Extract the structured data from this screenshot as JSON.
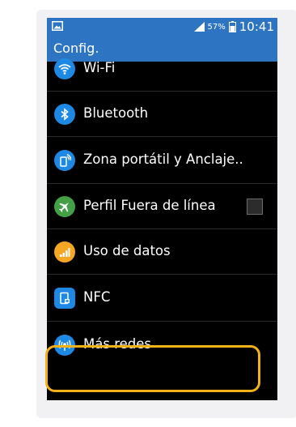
{
  "statusbar": {
    "battery": "57%",
    "time": "10:41"
  },
  "appbar": {
    "title": "Config."
  },
  "items": [
    {
      "label": "Wi-Fi",
      "icon": "wifi-icon",
      "color": "#1e88e5"
    },
    {
      "label": "Bluetooth",
      "icon": "bluetooth-icon",
      "color": "#1e88e5"
    },
    {
      "label": "Zona portátil y Anclaje..",
      "icon": "hotspot-icon",
      "color": "#1e88e5"
    },
    {
      "label": "Perfil Fuera de línea",
      "icon": "airplane-icon",
      "color": "#43a047",
      "checkbox": false
    },
    {
      "label": "Uso de datos",
      "icon": "data-usage-icon",
      "color": "#f5a623"
    },
    {
      "label": "NFC",
      "icon": "nfc-icon",
      "color": "#1e88e5"
    },
    {
      "label": "Más redes",
      "icon": "more-networks-icon",
      "color": "#1e88e5",
      "highlighted": true
    }
  ],
  "colors": {
    "accent": "#2d74c2",
    "highlight": "#f2b117"
  }
}
